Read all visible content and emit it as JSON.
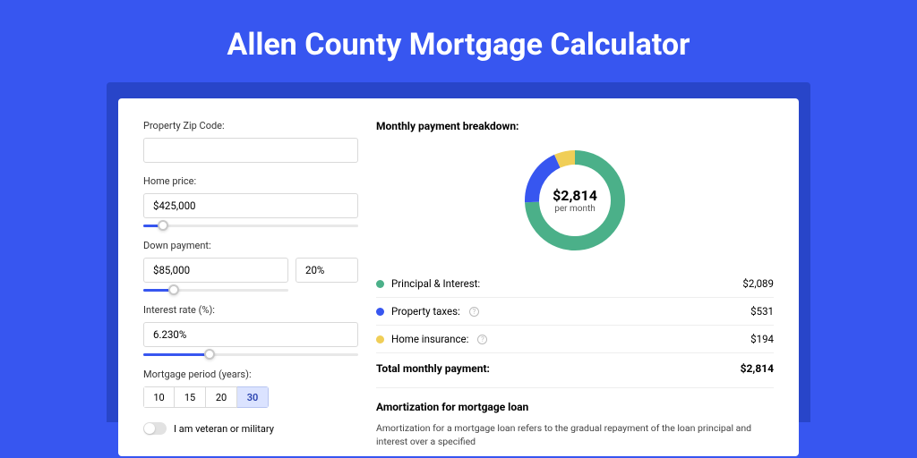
{
  "title": "Allen County Mortgage Calculator",
  "form": {
    "zip_label": "Property Zip Code:",
    "zip_value": "",
    "home_price_label": "Home price:",
    "home_price_value": "$425,000",
    "home_price_slider_pct": 9,
    "down_label": "Down payment:",
    "down_value": "$85,000",
    "down_pct_value": "20%",
    "down_slider_pct": 21,
    "rate_label": "Interest rate (%):",
    "rate_value": "6.230%",
    "rate_slider_pct": 31,
    "period_label": "Mortgage period (years):",
    "periods": [
      "10",
      "15",
      "20",
      "30"
    ],
    "period_active": 3,
    "veteran_label": "I am veteran or military"
  },
  "breakdown": {
    "title": "Monthly payment breakdown:",
    "center_amount": "$2,814",
    "center_sub": "per month",
    "rows": [
      {
        "label": "Principal & Interest:",
        "value": "$2,089",
        "color": "#4bb089",
        "info": false
      },
      {
        "label": "Property taxes:",
        "value": "$531",
        "color": "#3756f0",
        "info": true
      },
      {
        "label": "Home insurance:",
        "value": "$194",
        "color": "#f0ce57",
        "info": true
      }
    ],
    "total_label": "Total monthly payment:",
    "total_value": "$2,814"
  },
  "chart_data": {
    "type": "pie",
    "title": "Monthly payment breakdown",
    "series": [
      {
        "name": "Principal & Interest",
        "value": 2089,
        "color": "#4bb089"
      },
      {
        "name": "Property taxes",
        "value": 531,
        "color": "#3756f0"
      },
      {
        "name": "Home insurance",
        "value": 194,
        "color": "#f0ce57"
      }
    ],
    "total": 2814,
    "unit": "$ per month"
  },
  "amortization": {
    "title": "Amortization for mortgage loan",
    "text": "Amortization for a mortgage loan refers to the gradual repayment of the loan principal and interest over a specified"
  }
}
